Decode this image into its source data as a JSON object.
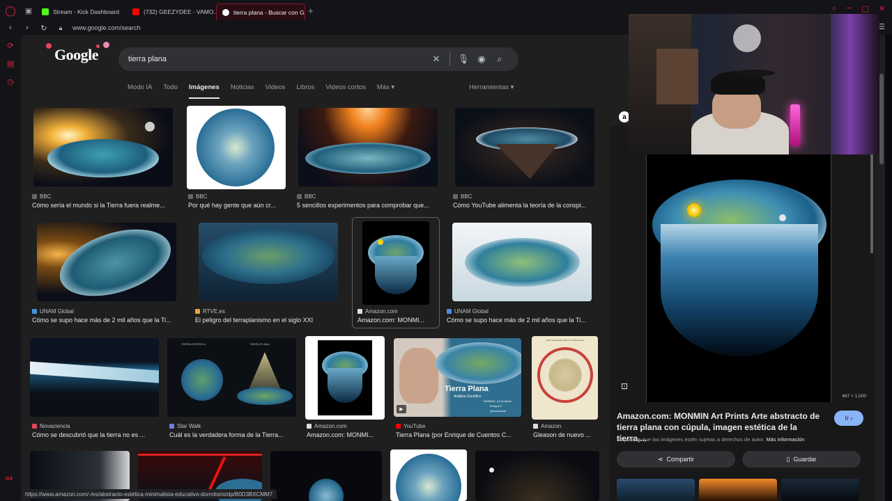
{
  "browser": {
    "tabs": [
      {
        "label": "Stream - Kick Dashboard",
        "color": "#53fc18"
      },
      {
        "label": "(732) GEEZYDEE - VAMO...",
        "color": "#ff0000"
      },
      {
        "label": "tierra plana - Buscar con G",
        "color": "#ffffff",
        "active": true
      }
    ],
    "url": "www.google.com/search",
    "status_url": "https://www.amazon.com/-/es/abstracto-estética-minimalista-educativo-dormitorio/dp/B0D3BXCMM7",
    "gx_label": "GX"
  },
  "google": {
    "logo": "Google",
    "query": "tierra plana",
    "nav": [
      "Modo IA",
      "Todo",
      "Imágenes",
      "Noticias",
      "Videos",
      "Libros",
      "Videos cortos",
      "Más"
    ],
    "active_nav": "Imágenes",
    "tools": "Herramientas"
  },
  "results": [
    {
      "source": "BBC",
      "caption": "Cómo sería el mundo si la Tierra fuera realme...",
      "fav": "#666666"
    },
    {
      "source": "BBC",
      "caption": "Por qué hay gente que aún cr...",
      "fav": "#666666"
    },
    {
      "source": "BBC",
      "caption": "5 sencillos experimentos para comprobar que...",
      "fav": "#666666"
    },
    {
      "source": "BBC",
      "caption": "Cómo YouTube alimenta la teoría de la conspi...",
      "fav": "#666666"
    },
    {
      "source": "UNAM Global",
      "caption": "Cómo se supo hace más de 2 mil años que la Ti...",
      "fav": "#4a90e2"
    },
    {
      "source": "RTVE.es",
      "caption": "El peligro del terraplanismo en el siglo XXI",
      "fav": "#e8a33d"
    },
    {
      "source": "Amazon.com",
      "caption": "Amazon.com: MONMI...",
      "fav": "#dddddd"
    },
    {
      "source": "UNAM Global",
      "caption": "Cómo se supo hace más de 2 mil años que la Ti...",
      "fav": "#4a90e2"
    },
    {
      "source": "Novaciencia",
      "caption": "Cómo se descubrió que la tierra no es ...",
      "fav": "#e8445a"
    },
    {
      "source": "Star Walk",
      "caption": "Cuál es la verdadera forma de la Tierra...",
      "fav": "#6a7fdb"
    },
    {
      "source": "Amazon.com",
      "caption": "Amazon.com: MONMI...",
      "fav": "#dddddd"
    },
    {
      "source": "YouTube",
      "caption": "Tierra Plana (por Enrique de Cuentos C...",
      "fav": "#ff0000"
    },
    {
      "source": "Amazon",
      "caption": "Gleason de nuevo ...",
      "fav": "#dddddd"
    }
  ],
  "thumb_text": {
    "tierra_plana": "Tierra Plana",
    "analisis": "Análisis Científico",
    "viernes": "VIERNES, 14 de febrer",
    "enrique": "Enrique F.",
    "cuentos": "@cuentoscie",
    "tierra_esferica": "TIERRA ESFÉRICA",
    "tierra_plana_caps": "TIERRA PLANA",
    "new_standard_map": "NEW STANDARD MAP OF THE WORLD"
  },
  "preview": {
    "title": "Amazon.com: MONMIN Art Prints Arte abstracto de tierra plana con cúpula, imagen estética de la tierra,...",
    "dims": "667 × 1,000",
    "go_label": "Ir",
    "rights_note": "Es posible que las imágenes estén sujetas a derechos de autor.",
    "more_info": "Más información",
    "share_label": "Compartir",
    "save_label": "Guardar",
    "badge": "a"
  }
}
